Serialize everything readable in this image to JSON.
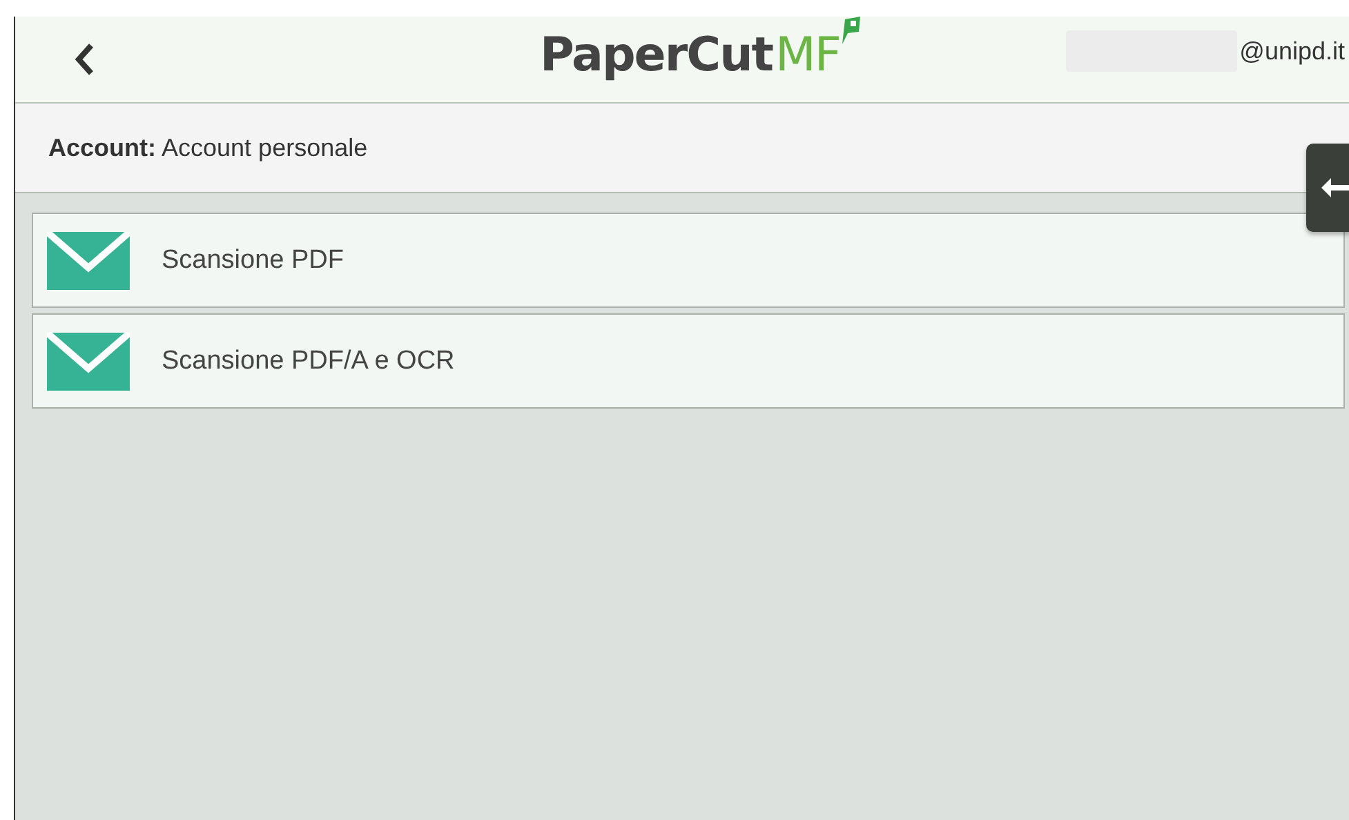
{
  "header": {
    "logo": {
      "main": "PaperCut",
      "suffix": "MF"
    },
    "user_domain": "@unipd.it"
  },
  "account_bar": {
    "label": "Account:",
    "value": "Account personale"
  },
  "actions": [
    {
      "label": "Scansione PDF"
    },
    {
      "label": "Scansione PDF/A e OCR"
    }
  ]
}
